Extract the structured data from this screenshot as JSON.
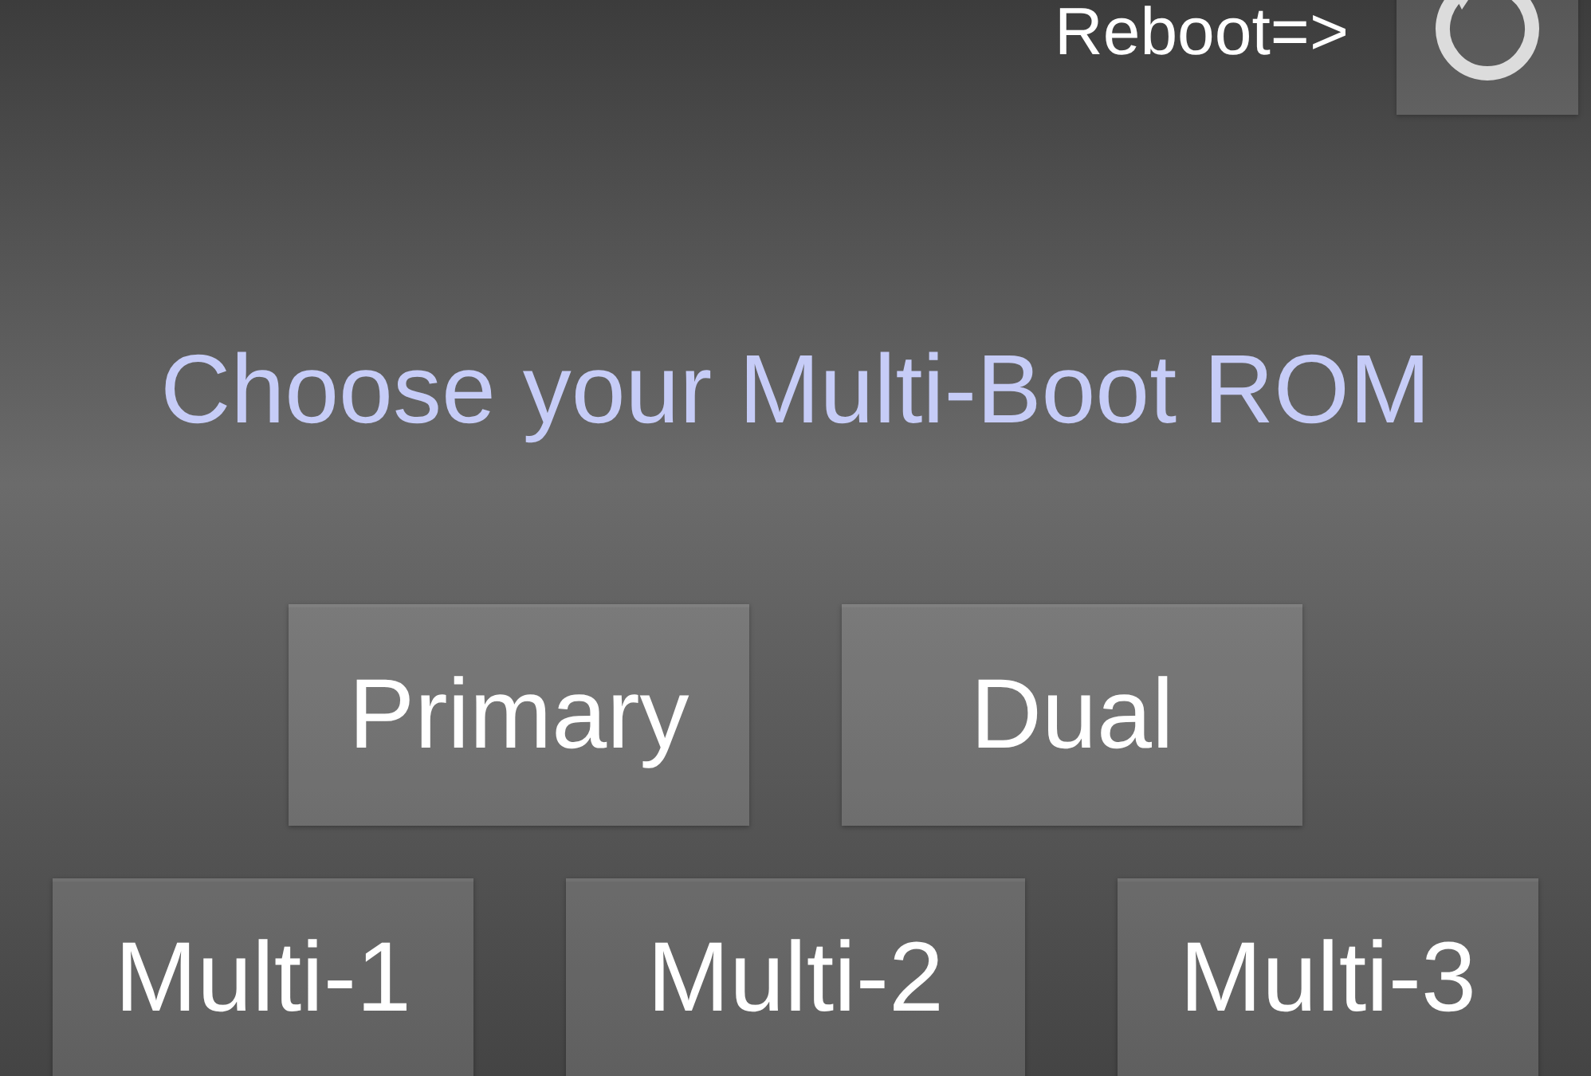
{
  "reboot_label": "Reboot=>",
  "title": "Choose your Multi-Boot ROM",
  "button_rows": [
    {
      "buttons": [
        {
          "label": "Primary"
        },
        {
          "label": "Dual"
        }
      ]
    },
    {
      "buttons": [
        {
          "label": "Multi-1"
        },
        {
          "label": "Multi-2"
        },
        {
          "label": "Multi-3"
        }
      ]
    }
  ]
}
